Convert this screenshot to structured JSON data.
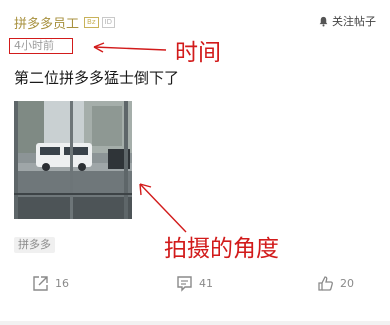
{
  "post": {
    "author": "拼多多员工",
    "badge1": "Bz",
    "badge2": "ID",
    "follow_label": "关注帖子",
    "time": "4小时前",
    "title": "第二位拼多多猛士倒下了",
    "tag": "拼多多"
  },
  "actions": {
    "share_count": "16",
    "comment_count": "41",
    "like_count": "20"
  },
  "annotations": {
    "time_label": "时间",
    "angle_label": "拍摄的角度"
  },
  "colors": {
    "annotation_red": "#d21b1b",
    "author_gold": "#a8913f"
  }
}
